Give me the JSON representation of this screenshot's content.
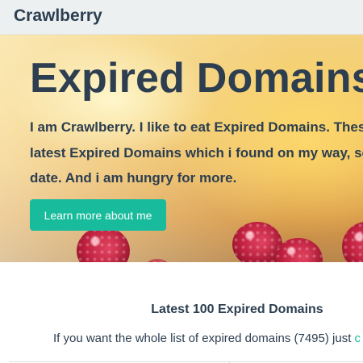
{
  "navbar": {
    "brand": "Crawlberry"
  },
  "hero": {
    "title": "Expired Domains",
    "lead_lines": [
      "I am Crawlberry. I like to eat Expired Domains. These",
      "latest Expired Domains which i found on my way, so",
      "date. And i am hungry for more."
    ],
    "button_label": "Learn more about me"
  },
  "latest": {
    "heading": "Latest 100 Expired Domains",
    "intro_text": "If you want the whole list of expired domains (7495) just ",
    "intro_link": "c"
  },
  "colors": {
    "navbar_bg": "#ecf0f1",
    "text": "#2c3e50",
    "accent": "#18bc9c"
  }
}
